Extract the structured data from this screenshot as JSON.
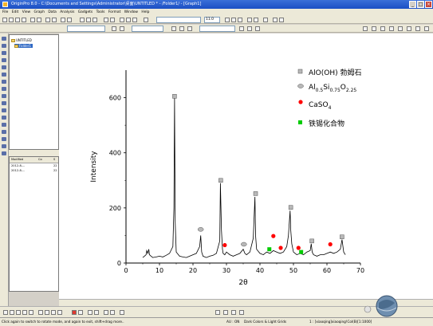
{
  "window": {
    "title": "OriginPro 8.0 - C:\\Documents and Settings\\Administrator\\桌面\\UNTITLED * - /Folder1/ - [Graph1]",
    "menu": [
      "File",
      "Edit",
      "View",
      "Graph",
      "Data",
      "Analysis",
      "Gadgets",
      "Tools",
      "Format",
      "Window",
      "Help"
    ],
    "toolbar_font_size": "11.0"
  },
  "explorer": {
    "root": "UNTITLED",
    "folder": "Folder1"
  },
  "project_list": {
    "columns": [
      "Modified",
      "Co",
      "S"
    ],
    "rows": [
      [
        "2012-8-...",
        "",
        "22"
      ],
      [
        "2012-8-...",
        "",
        "22"
      ]
    ]
  },
  "status": {
    "hint": "Click again to switch to rotate mode, and again to exit, shift+drag more..",
    "au": "AU : ON",
    "dark": "Dark Colors & Light Grids",
    "layer": "1 : [xiaoqing]xiaoqing!Col(B)[1:1000]"
  },
  "chart_data": {
    "type": "line",
    "title": "",
    "xlabel": "2θ",
    "ylabel": "Intensity",
    "xlim": [
      0,
      70
    ],
    "ylim": [
      0,
      700
    ],
    "x_ticks": [
      0,
      10,
      20,
      30,
      40,
      50,
      60,
      70
    ],
    "y_ticks": [
      0,
      200,
      400,
      600
    ],
    "grid": false,
    "legend_position": "top-right",
    "series": [
      {
        "x": [
          5,
          5.5,
          6,
          6.2,
          6.5,
          6.8,
          7,
          7.5,
          8,
          9,
          10,
          11,
          12,
          13,
          14,
          14.3,
          14.5,
          14.7,
          15,
          16,
          17,
          18,
          19,
          20,
          21,
          22,
          22.3,
          22.6,
          23,
          24,
          25,
          26,
          27,
          28,
          28.2,
          28.5,
          28.8,
          29,
          29.5,
          30,
          31,
          32,
          33,
          34,
          35,
          35.5,
          36,
          37,
          38,
          38.5,
          38.7,
          39,
          40,
          41,
          42,
          43,
          44,
          45,
          46,
          47,
          48,
          48.5,
          49,
          49.2,
          49.5,
          50,
          51,
          52,
          53,
          54,
          55,
          55.3,
          55.6,
          56,
          57,
          58,
          59,
          60,
          61,
          62,
          63,
          64,
          64.5,
          65,
          65.5
        ],
        "y": [
          20,
          25,
          30,
          45,
          35,
          50,
          30,
          25,
          20,
          22,
          25,
          22,
          28,
          35,
          60,
          200,
          600,
          150,
          40,
          25,
          22,
          20,
          25,
          30,
          35,
          60,
          100,
          40,
          25,
          20,
          25,
          28,
          35,
          80,
          290,
          120,
          50,
          35,
          30,
          40,
          30,
          25,
          30,
          35,
          50,
          35,
          30,
          40,
          90,
          240,
          100,
          50,
          35,
          30,
          40,
          35,
          45,
          40,
          35,
          40,
          60,
          100,
          190,
          120,
          70,
          40,
          30,
          35,
          30,
          40,
          45,
          70,
          40,
          30,
          25,
          30,
          30,
          35,
          40,
          35,
          40,
          50,
          85,
          40,
          30
        ]
      }
    ],
    "markers": [
      {
        "phase": "AlO(OH) 勃姆石",
        "points": [
          [
            14.5,
            605
          ],
          [
            28.3,
            300
          ],
          [
            38.7,
            252
          ],
          [
            49.2,
            202
          ],
          [
            55.5,
            80
          ],
          [
            64.5,
            95
          ]
        ]
      },
      {
        "phase": "Al0.5Si0.75O2.25",
        "points": [
          [
            22.3,
            122
          ],
          [
            35.2,
            68
          ]
        ]
      },
      {
        "phase": "CaSO4",
        "points": [
          [
            29.5,
            65
          ],
          [
            44,
            98
          ],
          [
            46.2,
            55
          ],
          [
            51.5,
            55
          ],
          [
            61,
            68
          ]
        ]
      },
      {
        "phase": "铁锡化合物",
        "points": [
          [
            42.8,
            50
          ],
          [
            52.3,
            40
          ]
        ]
      }
    ],
    "legend": [
      {
        "label": "AlO(OH) 勃姆石",
        "symbol": "square-gray"
      },
      {
        "label_base": "Al",
        "label_sub1": "0.5",
        "label_mid1": "Si",
        "label_sub2": "0.75",
        "label_mid2": "O",
        "label_sub3": "2.25",
        "symbol": "circle-gray"
      },
      {
        "label_base": "CaSO",
        "label_sub1": "4",
        "symbol": "circle-red"
      },
      {
        "label": "铁锡化合物",
        "symbol": "square-green"
      }
    ],
    "colors": {
      "line": "#000000",
      "red": "#ff0000",
      "green": "#00cc00",
      "gray": "#b8b8b8"
    }
  }
}
